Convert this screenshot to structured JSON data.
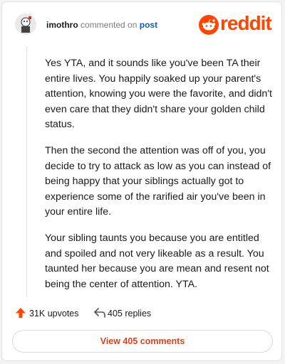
{
  "header": {
    "username": "imothro",
    "action_text": "commented on",
    "post_link": "post",
    "logo_text": "reddit"
  },
  "comment": {
    "paragraphs": [
      "Yes YTA, and it sounds like you've been TA their entire lives. You happily soaked up your parent's attention, knowing you were the favorite, and didn't even care that they didn't share your golden child status.",
      "Then the second the attention was off of you, you decide to try to attack as low as you can instead of being happy that your siblings actually got to experience some of the rarified air you've been in your entire life.",
      "Your sibling taunts you because you are entitled and spoiled and not very likeable as a result. You taunted her because you are mean and resent not being the center of attention. YTA."
    ]
  },
  "footer": {
    "upvotes": "31K upvotes",
    "replies": "405 replies",
    "upvote_icon": "upvote-arrow-icon",
    "reply_icon": "reply-arrow-icon"
  },
  "view_button": {
    "label": "View 405 comments"
  },
  "colors": {
    "accent": "#ff4500",
    "link": "#0b5eb8",
    "view_text": "#e0401a"
  }
}
